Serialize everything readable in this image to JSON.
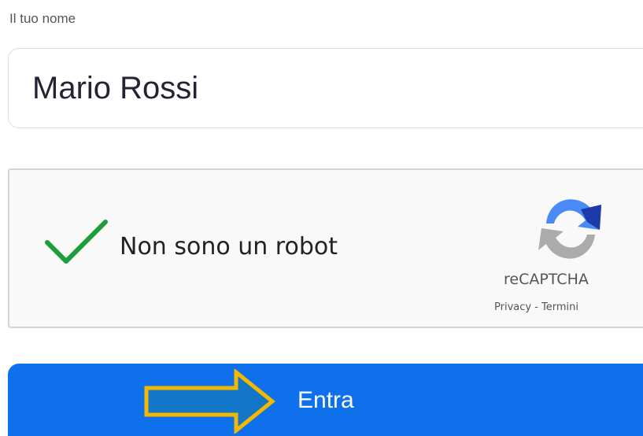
{
  "form": {
    "name_label": "Il tuo nome",
    "name_value": "Mario Rossi",
    "submit_label": "Entra"
  },
  "captcha": {
    "label": "Non sono un robot",
    "checked": true,
    "brand": "reCAPTCHA",
    "privacy_link": "Privacy",
    "separator": " - ",
    "terms_link": "Termini"
  },
  "annotation": {
    "arrow": "arrow-right-icon",
    "arrow_fill": "#1276c9",
    "arrow_stroke": "#f5b800"
  },
  "colors": {
    "primary": "#0e71eb",
    "check": "#1e9e3a"
  }
}
